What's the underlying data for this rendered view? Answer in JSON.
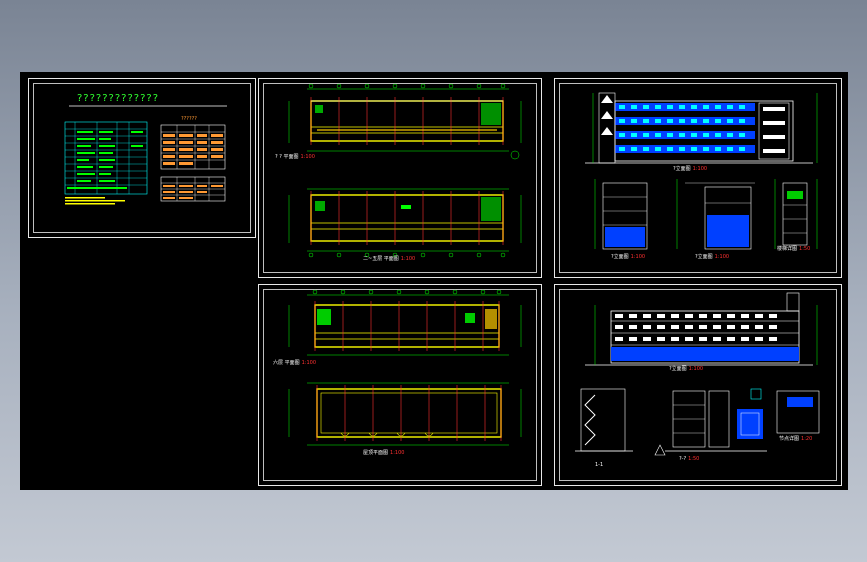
{
  "sheet1": {
    "title": "?????????????",
    "table_title": "??????"
  },
  "sheet2": {
    "plan_top_label": "?   ? 平面图",
    "plan_top_scale": "1:100",
    "plan_bottom_label": "二~五层 平面图",
    "plan_bottom_scale": "1:100"
  },
  "sheet3": {
    "elev_label": "?立面图",
    "elev_scale": "1:100",
    "sec_label": "?立面图",
    "sec_scale": "1:100",
    "side_label": "?立面图",
    "side_scale": "1:100",
    "stair_label": "楼梯详图",
    "stair_scale": "1:50"
  },
  "sheet4": {
    "plan_top_label": "六层 平面图",
    "plan_top_scale": "1:100",
    "roof_label": "屋顶平面图",
    "roof_scale": "1:100"
  },
  "sheet5": {
    "elev_label": "?立面图",
    "elev_scale": "1:100",
    "sec_label": "1-1",
    "detail_label": "?-?",
    "detail_scale": "1:50",
    "node_label": "节点详图",
    "node_scale": "1:20"
  },
  "colors": {
    "background": "#000000",
    "grid_cyan": "#00ffff",
    "wall_yellow": "#ffff00",
    "dim_green": "#00ff00",
    "axis_red": "#ff0000",
    "fill_blue": "#0040ff",
    "sheet_border": "#ffffff",
    "orange": "#ff9933"
  }
}
